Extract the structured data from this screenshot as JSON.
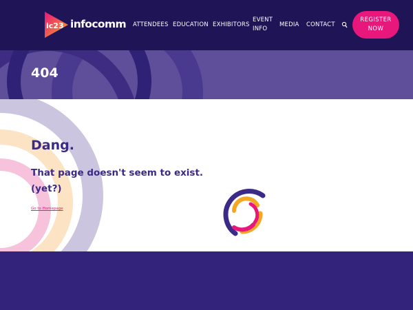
{
  "header": {
    "logo": {
      "mark_text": "ic23",
      "wordmark": "infocomm"
    },
    "nav": [
      {
        "lines": [
          "ATTENDEES"
        ]
      },
      {
        "lines": [
          "EDUCATION"
        ]
      },
      {
        "lines": [
          "EXHIBITORS"
        ]
      },
      {
        "lines": [
          "EVENT",
          "INFO"
        ]
      },
      {
        "lines": [
          "MEDIA"
        ]
      },
      {
        "lines": [
          "CONTACT"
        ]
      }
    ],
    "search_icon": "search-icon",
    "register": {
      "line1": "REGISTER",
      "line2": "NOW"
    }
  },
  "page": {
    "title": "404",
    "heading": "Dang.",
    "message": "That page doesn't seem to exist.",
    "aside": "(yet?)",
    "home_link": "Go to Homepage"
  },
  "colors": {
    "header_bg": "#1f1456",
    "title_band_bg": "#5f4f9b",
    "brand_purple": "#3b2a86",
    "brand_pink": "#e8177c",
    "brand_orange": "#f5a623",
    "footer_bg": "#34237a"
  }
}
